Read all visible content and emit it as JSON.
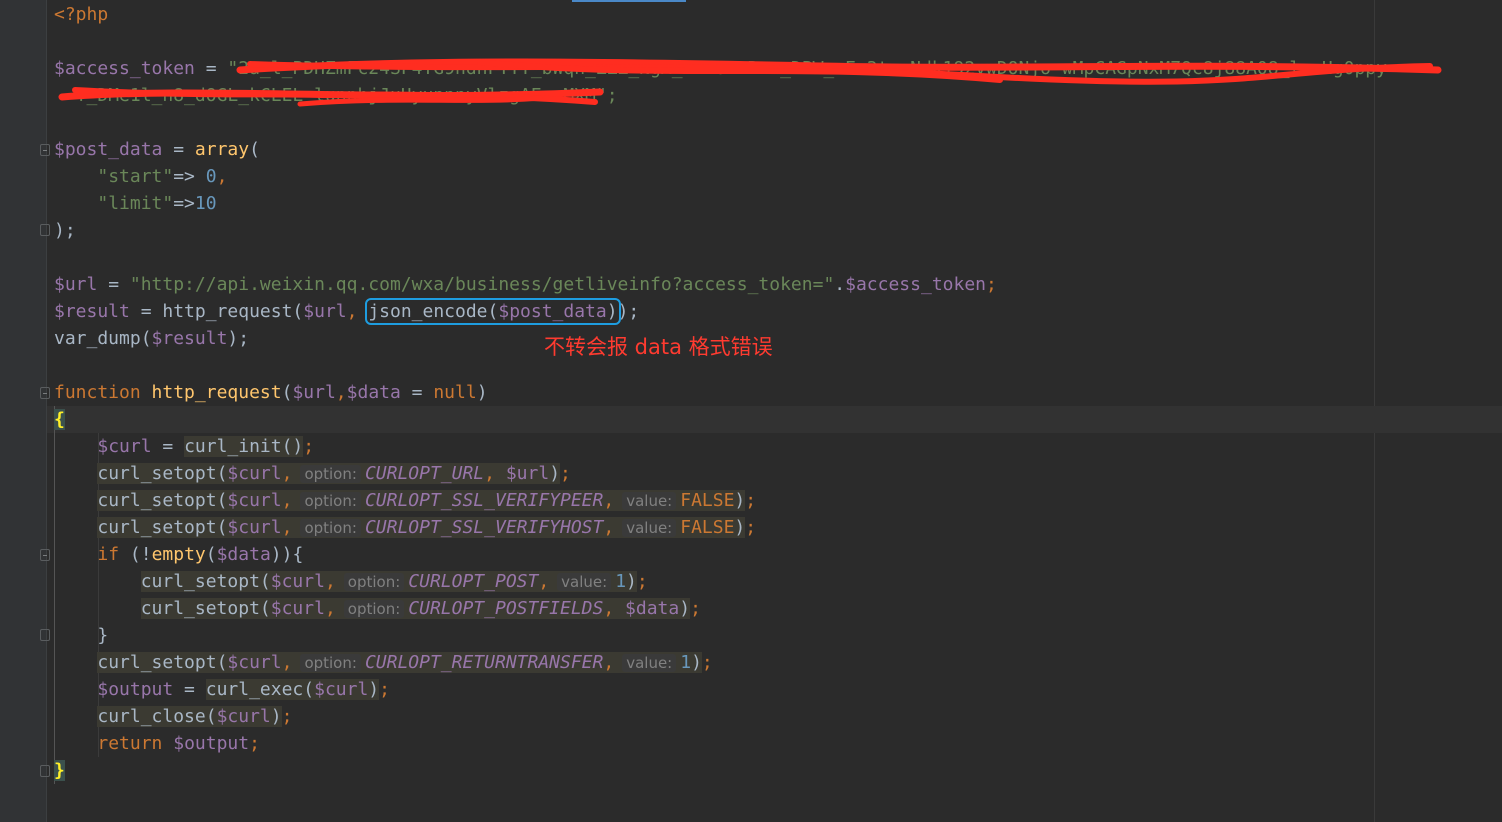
{
  "editor": {
    "lines": {
      "php_open": "<?php",
      "token_var": "$access_token",
      "token_eq": " = ",
      "token_val_1": "\"2a_l_PDHZmFc24SF4TG9hdnFTTT_bWqn_ZZZ_NgA_Mn7oNnRnn_DPW_wEc3tssNdk192vwDONjo-wMpCAGpNxM7Qc8j88A08_lnnHg0ppy",
      "token_val_2": "T_DMe1l_n8_dOGL_kCLEL_lunnhjJuUyunnnyVlzgAEnnMXM\";",
      "post_var": "$post_data",
      "post_eq": " = ",
      "post_array": "array",
      "post_paren": "(",
      "start_key": "\"start\"",
      "arrow": "=>",
      "start_val": " 0",
      "comma": ",",
      "limit_key": "\"limit\"",
      "limit_val": "10",
      "close_paren": ");",
      "url_var": "$url",
      "url_str": "\"http://api.weixin.qq.com/wxa/business/getliveinfo?access_token=\"",
      "dot": ".",
      "token_ref": "$access_token",
      "semi": ";",
      "result_var": "$result",
      "http_request_call": "http_request(",
      "url_arg": "$url",
      "comma_space": ", ",
      "json_encode": "json_encode(",
      "post_data_arg": "$post_data",
      "json_close": ")",
      "call_close": ");",
      "var_dump": "var_dump(",
      "result_arg": "$result",
      "function_kw": "function",
      "func_name": "http_request",
      "func_params_open": "(",
      "param_url": "$url",
      "param_data": "$data",
      "default_eq": " = ",
      "null_kw": "null",
      "func_params_close": ")",
      "open_brace": "{",
      "curl_var": "$curl",
      "curl_init": "curl_init()",
      "curl_setopt": "curl_setopt(",
      "option_hint": "option:",
      "value_hint": "value:",
      "opt_url": "CURLOPT_URL",
      "opt_verifypeer": "CURLOPT_SSL_VERIFYPEER",
      "opt_verifyhost": "CURLOPT_SSL_VERIFYHOST",
      "false_kw": "FALSE",
      "if_kw": "if",
      "not_empty": " (!",
      "empty_fn": "empty",
      "data_arg": "$data",
      "if_close": ")){",
      "opt_post": "CURLOPT_POST",
      "one": "1",
      "opt_postfields": "CURLOPT_POSTFIELDS",
      "if_end": "}",
      "opt_returntransfer": "CURLOPT_RETURNTRANSFER",
      "output_var": "$output",
      "curl_exec": "curl_exec(",
      "curl_close": "curl_close(",
      "return_kw": "return",
      "close_brace": "}"
    }
  },
  "annotation": {
    "note": "不转会报 data 格式错误",
    "note_color": "#ff3b30",
    "box_color": "#1e9de0"
  }
}
